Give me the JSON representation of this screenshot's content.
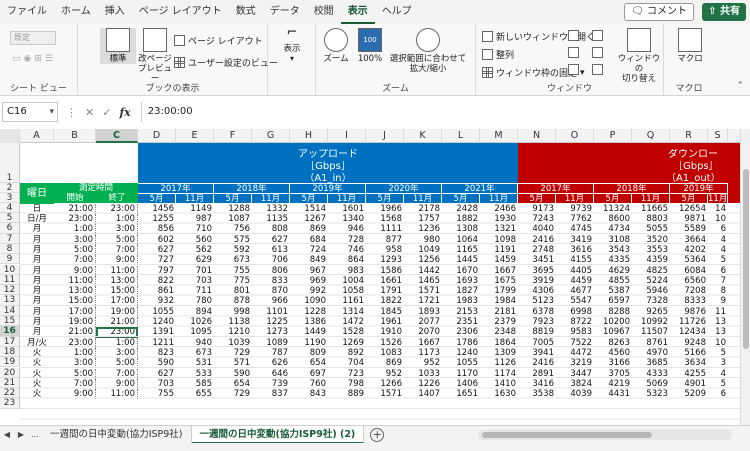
{
  "ribbon_tabs": [
    "ファイル",
    "ホーム",
    "挿入",
    "ページ レイアウト",
    "数式",
    "データ",
    "校閲",
    "表示",
    "ヘルプ"
  ],
  "active_tab": "表示",
  "comment_label": "コメント",
  "share_label": "共有",
  "ribbon": {
    "sheet_view": {
      "dropdown": "既定",
      "label": "シート ビュー"
    },
    "workbook_views": {
      "normal": "標準",
      "page_break": "改ページ\nプレビュー",
      "page_layout": "ページ レイアウト",
      "custom": "ユーザー設定のビュー",
      "label": "ブックの表示"
    },
    "show": {
      "button": "表示",
      "label": ""
    },
    "zoom": {
      "zoom": "ズーム",
      "hundred": "100%",
      "fit": "選択範囲に合わせて\n拡大/縮小",
      "label": "ズーム"
    },
    "window": {
      "new_window": "新しいウィンドウを開く",
      "arrange": "整列",
      "freeze": "ウィンドウ枠の固定",
      "switch": "ウィンドウの\n切り替え",
      "label": "ウィンドウ"
    },
    "macro": {
      "button": "マクロ",
      "label": "マクロ"
    }
  },
  "formula_bar": {
    "name_box": "C16",
    "value": "23:00:00"
  },
  "columns": [
    "A",
    "B",
    "C",
    "D",
    "E",
    "F",
    "G",
    "H",
    "I",
    "J",
    "K",
    "L",
    "M",
    "N",
    "O",
    "P",
    "Q",
    "R",
    "S"
  ],
  "selected_column": "C",
  "selected_row": "16",
  "row_numbers": [
    "1",
    "2",
    "3",
    "4",
    "5",
    "6",
    "7",
    "8",
    "9",
    "10",
    "11",
    "12",
    "13",
    "14",
    "15",
    "16",
    "17",
    "18",
    "19",
    "20",
    "21",
    "22",
    "23"
  ],
  "header": {
    "upload_title": "アップロード",
    "upload_unit": "［Gbps］",
    "upload_sub": "（A1_in）",
    "download_title": "ダウンロー",
    "download_unit": "［Gbps］",
    "download_sub": "（A1_out）",
    "weekday": "曜日",
    "measure_time": "測定時間",
    "start": "開始",
    "end": "終了",
    "years_up": [
      "2017年",
      "2018年",
      "2019年",
      "2020年",
      "2021年"
    ],
    "years_down": [
      "2017年",
      "2018年",
      "2019年"
    ],
    "months": [
      "5月",
      "11月",
      "5月",
      "11月",
      "5月",
      "11月",
      "5月",
      "11月",
      "5月",
      "11月",
      "5月",
      "11月",
      "5月",
      "11月",
      "5月",
      "11月"
    ]
  },
  "colors": {
    "upload_bg": "#0070c0",
    "download_bg": "#c00000",
    "time_bg": "#00b050",
    "accent": "#217346"
  },
  "rows": [
    [
      "日",
      "21:00",
      "23:00",
      "1456",
      "1149",
      "1288",
      "1332",
      "1514",
      "1601",
      "1966",
      "2178",
      "2428",
      "2466",
      "9173",
      "9739",
      "11324",
      "11665",
      "12654",
      "14"
    ],
    [
      "日/月",
      "23:00",
      "1:00",
      "1255",
      "987",
      "1087",
      "1135",
      "1267",
      "1340",
      "1568",
      "1757",
      "1882",
      "1930",
      "7243",
      "7762",
      "8600",
      "8803",
      "9871",
      "10"
    ],
    [
      "月",
      "1:00",
      "3:00",
      "856",
      "710",
      "756",
      "808",
      "869",
      "946",
      "1111",
      "1236",
      "1308",
      "1321",
      "4040",
      "4745",
      "4734",
      "5055",
      "5589",
      "6"
    ],
    [
      "月",
      "3:00",
      "5:00",
      "602",
      "560",
      "575",
      "627",
      "684",
      "728",
      "877",
      "980",
      "1064",
      "1098",
      "2416",
      "3419",
      "3108",
      "3520",
      "3664",
      "4"
    ],
    [
      "月",
      "5:00",
      "7:00",
      "627",
      "562",
      "592",
      "613",
      "724",
      "746",
      "958",
      "1049",
      "1165",
      "1191",
      "2748",
      "3616",
      "3543",
      "3553",
      "4202",
      "4"
    ],
    [
      "月",
      "7:00",
      "9:00",
      "727",
      "629",
      "673",
      "706",
      "849",
      "864",
      "1293",
      "1256",
      "1445",
      "1459",
      "3451",
      "4155",
      "4335",
      "4359",
      "5364",
      "5"
    ],
    [
      "月",
      "9:00",
      "11:00",
      "797",
      "701",
      "755",
      "806",
      "967",
      "983",
      "1586",
      "1442",
      "1670",
      "1667",
      "3695",
      "4405",
      "4629",
      "4825",
      "6084",
      "6"
    ],
    [
      "月",
      "11:00",
      "13:00",
      "822",
      "703",
      "775",
      "833",
      "969",
      "1004",
      "1661",
      "1465",
      "1693",
      "1675",
      "3919",
      "4459",
      "4855",
      "5224",
      "6560",
      "7"
    ],
    [
      "月",
      "13:00",
      "15:00",
      "861",
      "711",
      "801",
      "870",
      "992",
      "1058",
      "1791",
      "1571",
      "1827",
      "1799",
      "4306",
      "4677",
      "5387",
      "5946",
      "7208",
      "8"
    ],
    [
      "月",
      "15:00",
      "17:00",
      "932",
      "780",
      "878",
      "966",
      "1090",
      "1161",
      "1822",
      "1721",
      "1983",
      "1984",
      "5123",
      "5547",
      "6597",
      "7328",
      "8333",
      "9"
    ],
    [
      "月",
      "17:00",
      "19:00",
      "1055",
      "894",
      "998",
      "1101",
      "1228",
      "1314",
      "1845",
      "1893",
      "2153",
      "2181",
      "6378",
      "6998",
      "8288",
      "9265",
      "9876",
      "11"
    ],
    [
      "月",
      "19:00",
      "21:00",
      "1240",
      "1026",
      "1138",
      "1225",
      "1386",
      "1472",
      "1961",
      "2077",
      "2351",
      "2379",
      "7923",
      "8722",
      "10200",
      "10992",
      "11726",
      "13"
    ],
    [
      "月",
      "21:00",
      "23:00",
      "1391",
      "1095",
      "1210",
      "1273",
      "1449",
      "1528",
      "1910",
      "2070",
      "2306",
      "2348",
      "8819",
      "9583",
      "10967",
      "11507",
      "12434",
      "13"
    ],
    [
      "月/火",
      "23:00",
      "1:00",
      "1211",
      "940",
      "1039",
      "1089",
      "1190",
      "1269",
      "1526",
      "1667",
      "1786",
      "1864",
      "7005",
      "7522",
      "8263",
      "8761",
      "9248",
      "10"
    ],
    [
      "火",
      "1:00",
      "3:00",
      "823",
      "673",
      "729",
      "787",
      "809",
      "892",
      "1083",
      "1173",
      "1240",
      "1309",
      "3941",
      "4472",
      "4560",
      "4970",
      "5166",
      "5"
    ],
    [
      "火",
      "3:00",
      "5:00",
      "590",
      "531",
      "571",
      "626",
      "654",
      "704",
      "869",
      "952",
      "1055",
      "1126",
      "2416",
      "3219",
      "3166",
      "3685",
      "3634",
      "3"
    ],
    [
      "火",
      "5:00",
      "7:00",
      "627",
      "533",
      "590",
      "646",
      "697",
      "723",
      "952",
      "1033",
      "1170",
      "1174",
      "2891",
      "3447",
      "3705",
      "4333",
      "4255",
      "4"
    ],
    [
      "火",
      "7:00",
      "9:00",
      "703",
      "585",
      "654",
      "739",
      "760",
      "798",
      "1266",
      "1226",
      "1406",
      "1410",
      "3416",
      "3824",
      "4219",
      "5069",
      "4901",
      "5"
    ],
    [
      "火",
      "9:00",
      "11:00",
      "755",
      "655",
      "729",
      "837",
      "843",
      "889",
      "1571",
      "1407",
      "1651",
      "1630",
      "3538",
      "4039",
      "4431",
      "5323",
      "5209",
      "6"
    ]
  ],
  "sheet_tabs": [
    "一週間の日中変動(協力ISP9社)",
    "一週間の日中変動(協力ISP9社) (2)"
  ],
  "active_sheet": 1
}
